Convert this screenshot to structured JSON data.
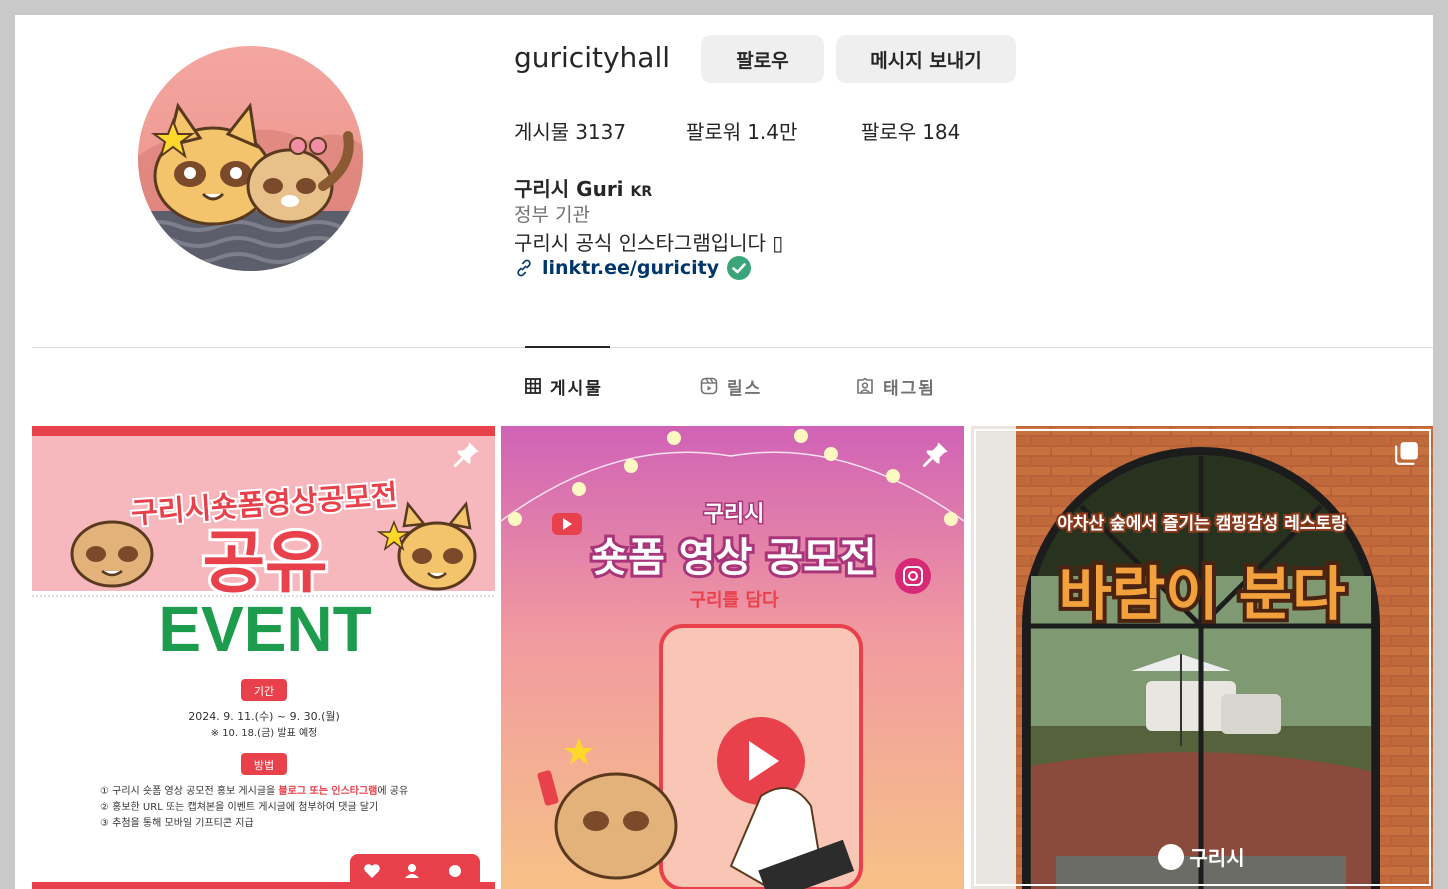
{
  "profile": {
    "username": "guricityhall",
    "follow_label": "팔로우",
    "message_label": "메시지 보내기",
    "stats": [
      {
        "label": "게시물",
        "value": "3137"
      },
      {
        "label": "팔로워",
        "value": "1.4만"
      },
      {
        "label": "팔로우",
        "value": "184"
      }
    ],
    "full_name": "구리시 Guri",
    "full_name_suffix": "KR",
    "category": "정부 기관",
    "bio": "구리시 공식 인스타그램입니다 ▯",
    "link": "linktr.ee/guricity"
  },
  "tabs": [
    {
      "label": "게시물",
      "icon": "grid-icon",
      "active": true
    },
    {
      "label": "릴스",
      "icon": "reels-icon",
      "active": false
    },
    {
      "label": "태그됨",
      "icon": "tagged-icon",
      "active": false
    }
  ],
  "posts": [
    {
      "pinned": true,
      "headline": "구리시숏폼영상공모전",
      "big_text": "공유",
      "event_text": "EVENT",
      "period_label": "기간",
      "period": "2024. 9. 11.(수) ~ 9. 30.(월)",
      "announce": "※ 10. 18.(금) 발표 예정",
      "method_label": "방법",
      "step1_a": "① 구리시 숏폼 영상 공모전 홍보 게시글을 ",
      "step1_b": "블로그 또는 인스타그램",
      "step1_c": "에 공유",
      "step2": "② 홍보한 URL 또는 캡쳐본을 이벤트 게시글에 첨부하여 댓글 달기",
      "step3": "③ 추첨을 통해 모바일 기프티콘 지급"
    },
    {
      "pinned": true,
      "city": "구리시",
      "title": "숏폼 영상 공모전",
      "subtitle": "구리를 담다"
    },
    {
      "pinned": false,
      "multi": true,
      "caption": "아차산 숲에서 즐기는 캠핑감성 레스토랑",
      "title": "바람이 분다",
      "logo": "구리시"
    }
  ],
  "colors": {
    "link": "#00376b",
    "verified": "#3aa57a",
    "button_bg": "#efefef",
    "event_green": "#1d9c4e",
    "event_red": "#e8414b"
  }
}
